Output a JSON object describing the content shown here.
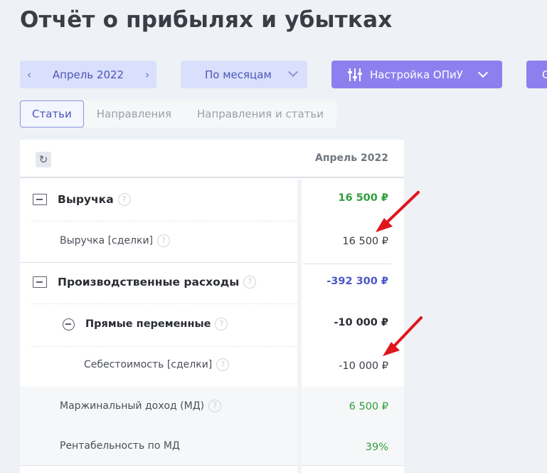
{
  "page": {
    "title": "Отчёт о прибылях и убытках"
  },
  "toolbar": {
    "period_label": "Апрель 2022",
    "groupby_label": "По месяцам",
    "setup_label": "Настройка ОПиУ",
    "cutoff_label": "С"
  },
  "tabs": [
    {
      "label": "Статьи",
      "active": true
    },
    {
      "label": "Направления",
      "active": false
    },
    {
      "label": "Направления и статьи",
      "active": false
    }
  ],
  "table": {
    "column_header": "Апрель 2022",
    "rows": [
      {
        "label": "Выручка",
        "value": "16 500 ₽"
      },
      {
        "label": "Выручка [сделки]",
        "value": "16 500 ₽"
      },
      {
        "label": "Производственные расходы",
        "value": "-392 300 ₽"
      },
      {
        "label": "Прямые переменные",
        "value": "-10 000 ₽"
      },
      {
        "label": "Себестоимость [сделки]",
        "value": "-10 000 ₽"
      },
      {
        "label": "Маржинальный доход (МД)",
        "value": "6 500 ₽"
      },
      {
        "label": "Рентабельность по МД",
        "value": "39%"
      }
    ]
  },
  "icons": {
    "help": "?",
    "refresh": "↻"
  },
  "colors": {
    "accent": "#8d80ee",
    "positive": "#2f9e3c",
    "expense": "#4c57c8",
    "annotation_arrow": "#e0151c"
  }
}
